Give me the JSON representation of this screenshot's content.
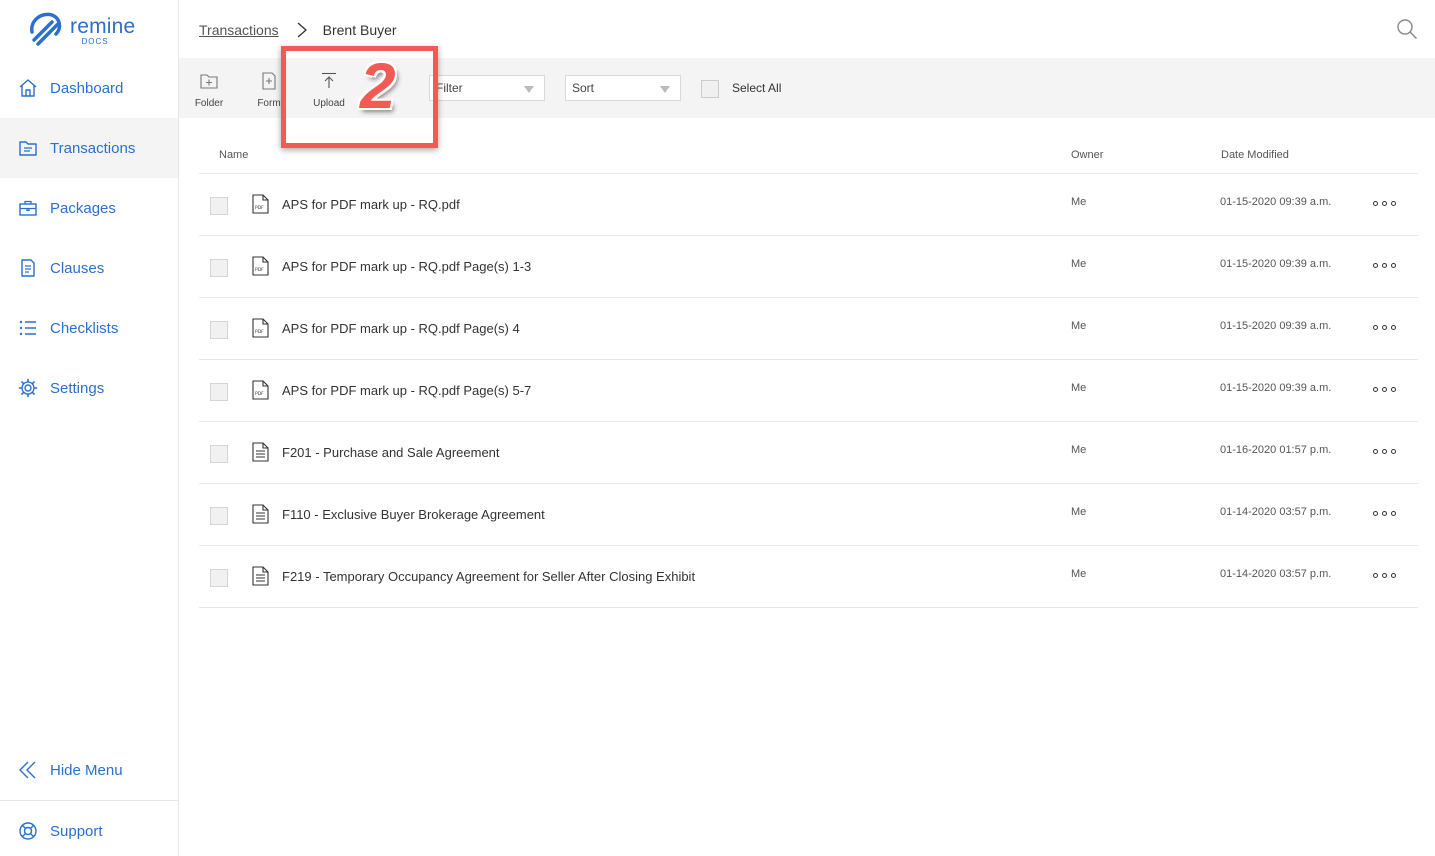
{
  "brand": {
    "name": "remine",
    "subtitle": "DOCS",
    "accent_color": "#2b6fcf"
  },
  "sidebar": {
    "items": [
      {
        "label": "Dashboard",
        "icon": "home-icon",
        "active": false
      },
      {
        "label": "Transactions",
        "icon": "folder-icon",
        "active": true
      },
      {
        "label": "Packages",
        "icon": "briefcase-icon",
        "active": false
      },
      {
        "label": "Clauses",
        "icon": "document-icon",
        "active": false
      },
      {
        "label": "Checklists",
        "icon": "list-icon",
        "active": false
      },
      {
        "label": "Settings",
        "icon": "gear-icon",
        "active": false
      }
    ],
    "hide_menu_label": "Hide Menu",
    "support_label": "Support"
  },
  "breadcrumb": {
    "parent": "Transactions",
    "current": "Brent Buyer"
  },
  "toolbar": {
    "folder_label": "Folder",
    "form_label": "Form",
    "upload_label": "Upload",
    "filter_label": "Filter",
    "sort_label": "Sort",
    "select_all_label": "Select All"
  },
  "annotation": {
    "number": "2",
    "color": "#f25a55"
  },
  "table": {
    "columns": {
      "name": "Name",
      "owner": "Owner",
      "date_modified": "Date Modified"
    },
    "rows": [
      {
        "name": "APS for PDF mark up - RQ.pdf",
        "type": "pdf",
        "owner": "Me",
        "date": "01-15-2020 09:39 a.m."
      },
      {
        "name": "APS for PDF mark up - RQ.pdf Page(s) 1-3",
        "type": "pdf",
        "owner": "Me",
        "date": "01-15-2020 09:39 a.m."
      },
      {
        "name": "APS for PDF mark up - RQ.pdf Page(s) 4",
        "type": "pdf",
        "owner": "Me",
        "date": "01-15-2020 09:39 a.m."
      },
      {
        "name": "APS for PDF mark up - RQ.pdf Page(s) 5-7",
        "type": "pdf",
        "owner": "Me",
        "date": "01-15-2020 09:39 a.m."
      },
      {
        "name": "F201 - Purchase and Sale Agreement",
        "type": "form",
        "owner": "Me",
        "date": "01-16-2020 01:57 p.m."
      },
      {
        "name": "F110 - Exclusive Buyer Brokerage Agreement",
        "type": "form",
        "owner": "Me",
        "date": "01-14-2020 03:57 p.m."
      },
      {
        "name": "F219 - Temporary Occupancy Agreement for Seller After Closing Exhibit",
        "type": "form",
        "owner": "Me",
        "date": "01-14-2020 03:57 p.m."
      }
    ]
  }
}
